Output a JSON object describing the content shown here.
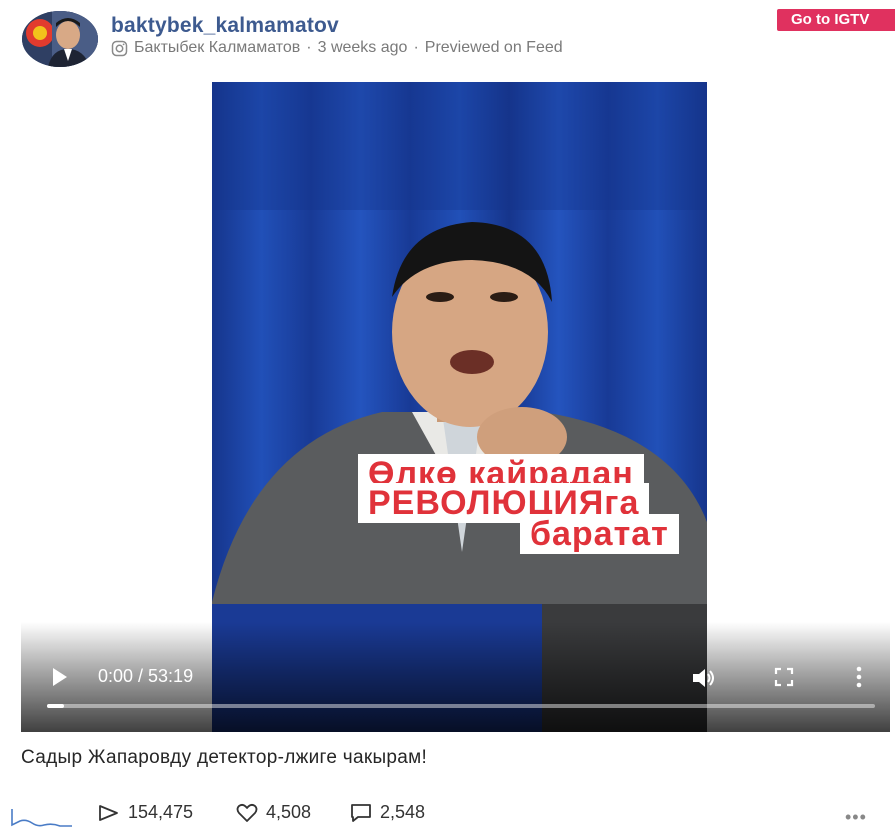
{
  "post": {
    "username": "baktybek_kalmamatov",
    "display_name": "Бактыбек Калмаматов",
    "posted_ago": "3 weeks ago",
    "preview_context": "Previewed on Feed",
    "meta_separator": "·",
    "go_to_button": "Go to IGTV",
    "title": "Садыр Жапаровду детектор-лжиге чакырам!"
  },
  "video": {
    "caption_lines": [
      "Өлкө кайрадан",
      "РЕВОЛЮЦИЯга",
      "баратат"
    ],
    "current_time": "0:00",
    "duration": "53:19",
    "time_display": "0:00 / 53:19",
    "progress": 0.0
  },
  "stats": {
    "views": "154,475",
    "likes": "4,508",
    "comments": "2,548",
    "more_label": "•••"
  },
  "icons": {
    "source": "instagram-icon",
    "play": "play-icon",
    "volume": "volume-icon",
    "fullscreen": "fullscreen-icon",
    "more": "more-vertical-icon",
    "views": "play-outline-icon",
    "likes": "heart-icon",
    "comments": "comment-icon",
    "sparkline": "views-trend-icon"
  },
  "colors": {
    "username": "#3d5a8f",
    "go_button": "#e0315f",
    "caption_text": "#e0323a",
    "curtain": "#1b3f9e"
  }
}
